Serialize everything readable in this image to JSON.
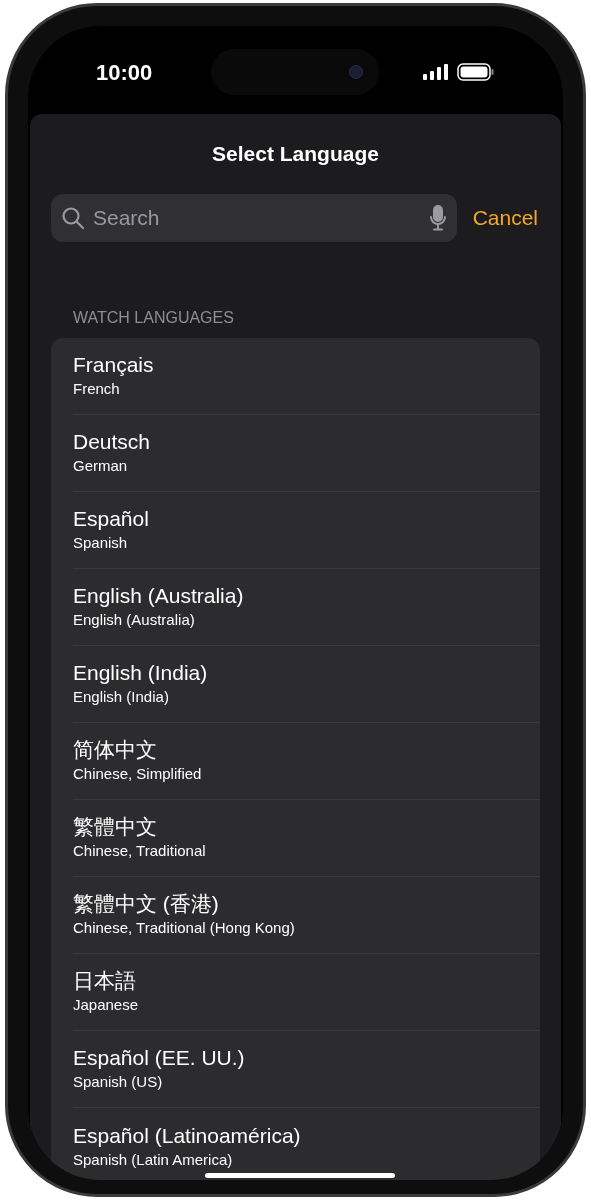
{
  "status_bar": {
    "time": "10:00"
  },
  "sheet": {
    "title": "Select Language"
  },
  "search": {
    "placeholder": "Search",
    "cancel": "Cancel"
  },
  "section": {
    "header": "WATCH LANGUAGES"
  },
  "languages": [
    {
      "name": "Français",
      "subtitle": "French"
    },
    {
      "name": "Deutsch",
      "subtitle": "German"
    },
    {
      "name": "Español",
      "subtitle": "Spanish"
    },
    {
      "name": "English (Australia)",
      "subtitle": "English (Australia)"
    },
    {
      "name": "English (India)",
      "subtitle": "English (India)"
    },
    {
      "name": "简体中文",
      "subtitle": "Chinese, Simplified"
    },
    {
      "name": "繁體中文",
      "subtitle": "Chinese, Traditional"
    },
    {
      "name": "繁體中文 (香港)",
      "subtitle": "Chinese, Traditional (Hong Kong)"
    },
    {
      "name": "日本語",
      "subtitle": "Japanese"
    },
    {
      "name": "Español (EE. UU.)",
      "subtitle": "Spanish (US)"
    },
    {
      "name": "Español (Latinoamérica)",
      "subtitle": "Spanish (Latin America)"
    }
  ]
}
